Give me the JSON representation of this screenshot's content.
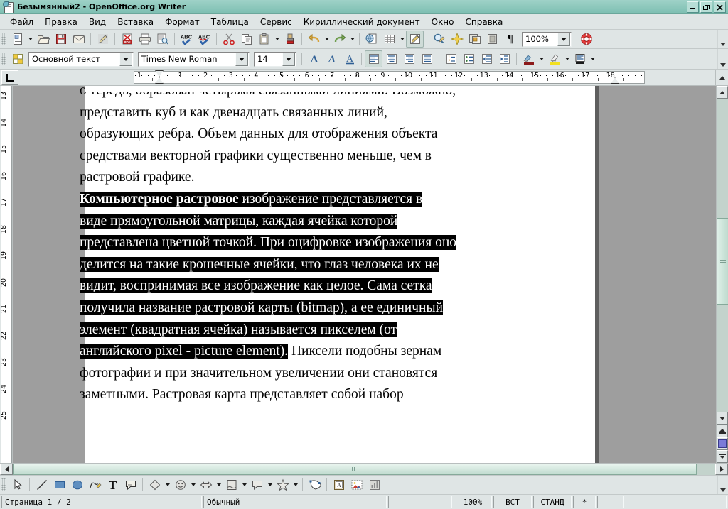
{
  "window": {
    "title": "Безымянный2 - OpenOffice.org Writer",
    "icon": "writer-document-icon",
    "buttons": [
      {
        "name": "minimize-button",
        "glyph": "–"
      },
      {
        "name": "maximize-button",
        "glyph": "❐"
      },
      {
        "name": "close-button",
        "glyph": "✕"
      }
    ]
  },
  "menubar": {
    "items": [
      {
        "label": "Файл",
        "accel": "Ф"
      },
      {
        "label": "Правка",
        "accel": "П"
      },
      {
        "label": "Вид",
        "accel": "В"
      },
      {
        "label": "Вставка",
        "accel": "с"
      },
      {
        "label": "Формат",
        "accel": ""
      },
      {
        "label": "Таблица",
        "accel": "Т"
      },
      {
        "label": "Сервис",
        "accel": "е"
      },
      {
        "label": "Кириллический документ",
        "accel": ""
      },
      {
        "label": "Окно",
        "accel": "О"
      },
      {
        "label": "Справка",
        "accel": "а"
      }
    ]
  },
  "standard_toolbar": {
    "items": [
      {
        "name": "new-document-button",
        "tip": "Создать"
      },
      {
        "name": "new-document-dropdown",
        "tip": "Создать (меню)"
      },
      {
        "name": "open-button",
        "tip": "Открыть"
      },
      {
        "name": "save-button",
        "tip": "Сохранить"
      },
      {
        "name": "email-document-button",
        "tip": "Документ как e-mail"
      },
      {
        "name": "edit-file-button",
        "tip": "Режим правки"
      },
      {
        "name": "export-pdf-button",
        "tip": "Экспорт в PDF"
      },
      {
        "name": "print-button",
        "tip": "Печать"
      },
      {
        "name": "print-preview-button",
        "tip": "Предварительный просмотр"
      },
      {
        "name": "spellcheck-button",
        "tip": "Проверка орфографии"
      },
      {
        "name": "autospellcheck-button",
        "tip": "Автопроверка орфографии"
      },
      {
        "name": "cut-button",
        "tip": "Вырезать"
      },
      {
        "name": "copy-button",
        "tip": "Копировать"
      },
      {
        "name": "paste-button",
        "tip": "Вставить"
      },
      {
        "name": "paste-dropdown",
        "tip": "Вставить (меню)"
      },
      {
        "name": "clone-formatting-button",
        "tip": "Копировать форматирование"
      },
      {
        "name": "undo-button",
        "tip": "Отменить"
      },
      {
        "name": "undo-dropdown",
        "tip": "Отменить (меню)"
      },
      {
        "name": "redo-button",
        "tip": "Вернуть"
      },
      {
        "name": "redo-dropdown",
        "tip": "Вернуть (меню)"
      },
      {
        "name": "hyperlink-button",
        "tip": "Гиперссылка"
      },
      {
        "name": "insert-table-button",
        "tip": "Таблица"
      },
      {
        "name": "insert-table-dropdown",
        "tip": "Таблица (меню)"
      },
      {
        "name": "show-draw-functions-button",
        "tip": "Показать функции рисования",
        "active": true
      },
      {
        "name": "find-replace-button",
        "tip": "Найти и заменить"
      },
      {
        "name": "gallery-button",
        "tip": "Галерея"
      },
      {
        "name": "navigator-button",
        "tip": "Навигатор"
      },
      {
        "name": "page-preview-button",
        "tip": "Просмотр страницы"
      },
      {
        "name": "formatting-marks-button",
        "tip": "Непечатаемые символы",
        "glyph": "¶"
      },
      {
        "name": "help-button",
        "tip": "Справка OpenOffice.org"
      }
    ],
    "zoom": {
      "value": "100%",
      "name": "zoom-combo"
    }
  },
  "formatting_toolbar": {
    "paragraph_style": {
      "value": "Основной текст",
      "name": "paragraph-style-combo"
    },
    "font_name": {
      "value": "Times New Roman",
      "name": "font-name-combo"
    },
    "font_size": {
      "value": "14",
      "name": "font-size-combo"
    },
    "buttons": [
      {
        "name": "bold-button",
        "glyph": "A",
        "tip": "Полужирный"
      },
      {
        "name": "italic-button",
        "glyph": "A",
        "tip": "Курсив"
      },
      {
        "name": "underline-button",
        "glyph": "A",
        "tip": "Подчёркнутый"
      },
      {
        "name": "align-left-button",
        "tip": "По левому краю",
        "active": true
      },
      {
        "name": "align-center-button",
        "tip": "По центру"
      },
      {
        "name": "align-right-button",
        "tip": "По правому краю"
      },
      {
        "name": "align-justify-button",
        "tip": "По ширине"
      },
      {
        "name": "numbered-list-button",
        "tip": "Нумерованный список"
      },
      {
        "name": "bulleted-list-button",
        "tip": "Маркированный список"
      },
      {
        "name": "decrease-indent-button",
        "tip": "Уменьшить отступ"
      },
      {
        "name": "increase-indent-button",
        "tip": "Увеличить отступ"
      },
      {
        "name": "font-color-button",
        "tip": "Цвет шрифта"
      },
      {
        "name": "font-color-dropdown",
        "tip": "Цвет шрифта (меню)"
      },
      {
        "name": "highlighting-button",
        "tip": "Выделение цветом"
      },
      {
        "name": "highlighting-dropdown",
        "tip": "Выделение цветом (меню)"
      },
      {
        "name": "background-color-button",
        "tip": "Цвет фона"
      },
      {
        "name": "background-color-dropdown",
        "tip": "Цвет фона (меню)"
      }
    ]
  },
  "ruler": {
    "tab_selector": "tab-stop-left",
    "horizontal_ticks": [
      "1",
      "1",
      "2",
      "3",
      "4",
      "5",
      "6",
      "7",
      "8",
      "9",
      "10",
      "11",
      "12",
      "13",
      "14",
      "15",
      "16",
      "17",
      "18"
    ],
    "vertical_ticks": [
      "13",
      "14",
      "15",
      "16",
      "17",
      "18",
      "19",
      "20",
      "21",
      "22",
      "23",
      "24",
      "25"
    ],
    "unit": "cm"
  },
  "document": {
    "paragraphs": [
      {
        "name": "paragraph-clipped-top",
        "lines": [
          {
            "runs": [
              {
                "text": "о тередь, образован четырьмя связанными линиями. Возможно,",
                "selected": false
              }
            ]
          }
        ]
      },
      {
        "name": "paragraph-vector",
        "lines": [
          {
            "runs": [
              {
                "text": "представить куб и как двенадцать связанных линий,",
                "selected": false
              }
            ]
          },
          {
            "runs": [
              {
                "text": "образующих ребра.  Объем данных для отображения объекта",
                "selected": false
              }
            ]
          },
          {
            "runs": [
              {
                "text": "средствами векторной графики существенно меньше, чем в",
                "selected": false
              }
            ]
          },
          {
            "runs": [
              {
                "text": "растровой графике.",
                "selected": false
              }
            ]
          }
        ]
      },
      {
        "name": "paragraph-raster",
        "lines": [
          {
            "runs": [
              {
                "text": " Компьютерное растровое",
                "selected": true,
                "bold": true
              },
              {
                "text": " изображение представляется в",
                "selected": true,
                "bold": false
              }
            ]
          },
          {
            "runs": [
              {
                "text": "виде прямоугольной матрицы, каждая ячейка которой",
                "selected": true
              }
            ]
          },
          {
            "runs": [
              {
                "text": "представлена цветной точкой. При оцифровке изображения оно",
                "selected": true
              }
            ]
          },
          {
            "runs": [
              {
                "text": "делится на такие крошечные ячейки, что глаз человека их не",
                "selected": true
              }
            ]
          },
          {
            "runs": [
              {
                "text": "видит, воспринимая все изображение как целое. Сама сетка",
                "selected": true
              }
            ]
          },
          {
            "runs": [
              {
                "text": "получила название растровой карты (bitmap), а ее единичный",
                "selected": true
              }
            ]
          },
          {
            "runs": [
              {
                "text": "элемент (квадратная ячейка) называется пикселем (от",
                "selected": true
              }
            ]
          },
          {
            "runs": [
              {
                "text": "английского pixel - picture element).",
                "selected": true
              },
              {
                "text": " Пиксели подобны зернам",
                "selected": false
              }
            ]
          },
          {
            "runs": [
              {
                "text": "фотографии и при значительном увеличении они становятся",
                "selected": false
              }
            ]
          },
          {
            "runs": [
              {
                "text": "заметными. Растровая карта представляет собой набор",
                "selected": false
              }
            ]
          }
        ]
      }
    ]
  },
  "draw_toolbar": {
    "items": [
      {
        "name": "select-tool-button",
        "tip": "Выделить"
      },
      {
        "name": "line-tool-button",
        "tip": "Линия"
      },
      {
        "name": "rectangle-tool-button",
        "tip": "Прямоугольник"
      },
      {
        "name": "ellipse-tool-button",
        "tip": "Эллипс"
      },
      {
        "name": "freeform-line-tool-button",
        "tip": "Кривая"
      },
      {
        "name": "text-tool-button",
        "glyph": "T",
        "tip": "Текст"
      },
      {
        "name": "callout-tool-button",
        "tip": "Выноска"
      },
      {
        "name": "basic-shapes-button",
        "tip": "Основные фигуры"
      },
      {
        "name": "basic-shapes-dropdown",
        "tip": "Основные фигуры (меню)"
      },
      {
        "name": "symbol-shapes-button",
        "tip": "Фигуры-символы"
      },
      {
        "name": "symbol-shapes-dropdown",
        "tip": "Фигуры-символы (меню)"
      },
      {
        "name": "block-arrows-button",
        "tip": "Блочные стрелки"
      },
      {
        "name": "block-arrows-dropdown",
        "tip": "Блочные стрелки (меню)"
      },
      {
        "name": "flowchart-shapes-button",
        "tip": "Блок-схемы"
      },
      {
        "name": "flowchart-shapes-dropdown",
        "tip": "Блок-схемы (меню)"
      },
      {
        "name": "callout-shapes-button",
        "tip": "Выноски"
      },
      {
        "name": "callout-shapes-dropdown",
        "tip": "Выноски (меню)"
      },
      {
        "name": "stars-shapes-button",
        "tip": "Звёзды"
      },
      {
        "name": "stars-shapes-dropdown",
        "tip": "Звёзды (меню)"
      },
      {
        "name": "points-button",
        "tip": "Изменение геометрии"
      },
      {
        "name": "fontwork-gallery-button",
        "tip": "Галерея текстовых эффектов"
      },
      {
        "name": "insert-image-button",
        "tip": "Из файла"
      },
      {
        "name": "insert-chart-button",
        "tip": "Диаграмма"
      }
    ]
  },
  "statusbar": {
    "page": "Страница  1 / 2",
    "page_style": "Обычный",
    "zoom": "100%",
    "insert_mode": "ВСТ",
    "selection_mode": "СТАНД",
    "modified": "*",
    "digital_signature": "",
    "extra": ""
  },
  "colors": {
    "title_bar": "#8fc9bd",
    "toolbar_bg": "#dfe5e5",
    "canvas_bg": "#9e9e9e",
    "page_bg": "#ffffff",
    "selection_bg": "#000000",
    "selection_fg": "#ffffff",
    "scrollbar_track": "#c3d3cc"
  }
}
